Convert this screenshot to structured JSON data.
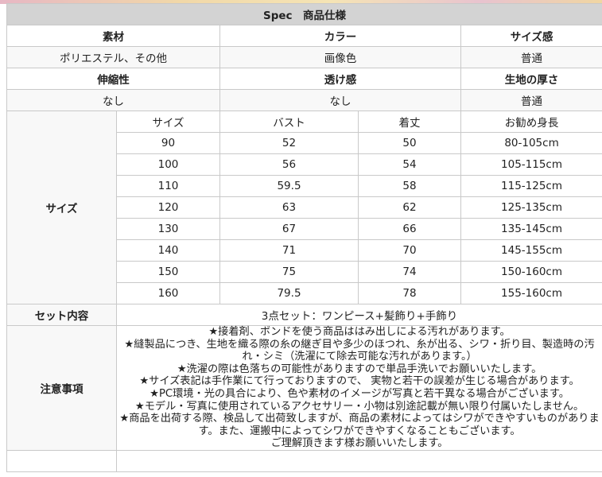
{
  "title": "Spec　商品仕様",
  "row1": {
    "h1": "素材",
    "h2": "カラー",
    "h3": "サイズ感",
    "v1": "ポリエステル、その他",
    "v2": "画像色",
    "v3": "普通"
  },
  "row2": {
    "h1": "伸縮性",
    "h2": "透け感",
    "h3": "生地の厚さ",
    "v1": "なし",
    "v2": "なし",
    "v3": "普通"
  },
  "size_table": {
    "label": "サイズ",
    "headers": [
      "サイズ",
      "バスト",
      "着丈",
      "お勧め身長"
    ],
    "rows": [
      [
        "90",
        "52",
        "50",
        "80-105cm"
      ],
      [
        "100",
        "56",
        "54",
        "105-115cm"
      ],
      [
        "110",
        "59.5",
        "58",
        "115-125cm"
      ],
      [
        "120",
        "63",
        "62",
        "125-135cm"
      ],
      [
        "130",
        "67",
        "66",
        "135-145cm"
      ],
      [
        "140",
        "71",
        "70",
        "145-155cm"
      ],
      [
        "150",
        "75",
        "74",
        "150-160cm"
      ],
      [
        "160",
        "79.5",
        "78",
        "155-160cm"
      ]
    ]
  },
  "set": {
    "label": "セット内容",
    "value": "3点セット：ワンピース+髪飾り+手飾り"
  },
  "notes": {
    "label": "注意事項",
    "lines": [
      "★接着剤、ボンドを使う商品ははみ出しによる汚れがあります。",
      "★縫製品につき、生地を織る際の糸の継ぎ目や多少のほつれ、糸が出る、シワ・折り目、製造時の汚れ・シミ（洗濯にて除去可能な汚れがあります。）",
      "★洗濯の際は色落ちの可能性がありますので単品手洗いでお願いいたします。",
      "★サイズ表記は手作業にて行っておりますので、 実物と若干の誤差が生じる場合があります。",
      "★PC環境・光の具合により、色や素材のイメージが写真と若干異なる場合がございます。",
      "★モデル・写真に使用されているアクセサリー・小物は別途記載が無い限り付属いたしません。",
      "★商品を出荷する際、検品して出荷致しますが、商品の素材によってはシワができやすいものがあります。また、運搬中によってシワができやすくなることもございます。",
      "ご理解頂きます様お願いいたします。"
    ]
  }
}
